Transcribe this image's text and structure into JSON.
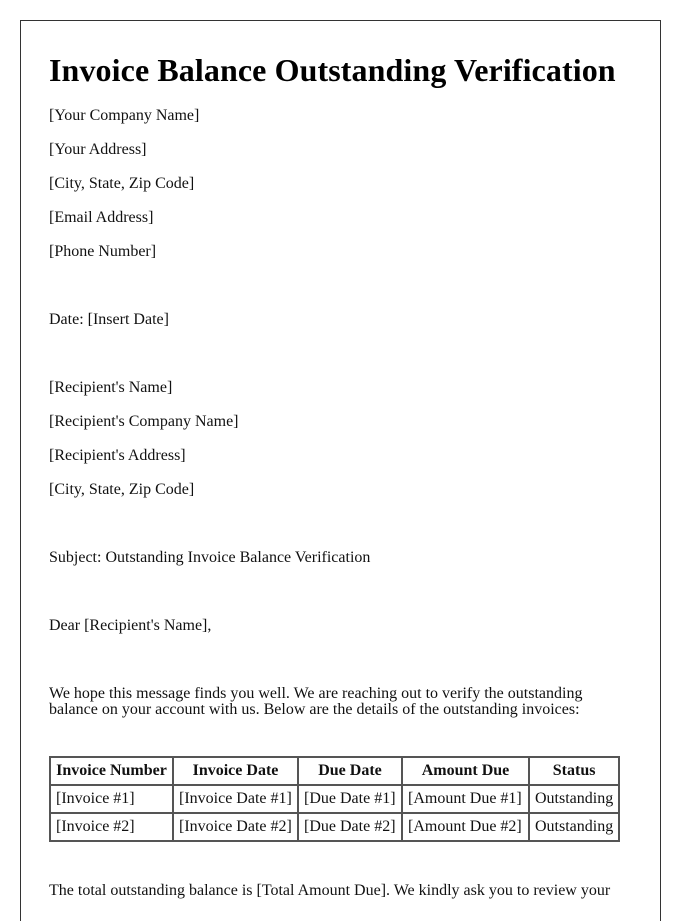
{
  "title": "Invoice Balance Outstanding Verification",
  "sender": {
    "company": "[Your Company Name]",
    "address": "[Your Address]",
    "city_state_zip": "[City, State, Zip Code]",
    "email": "[Email Address]",
    "phone": "[Phone Number]"
  },
  "date_line": "Date: [Insert Date]",
  "recipient": {
    "name": "[Recipient's Name]",
    "company": "[Recipient's Company Name]",
    "address": "[Recipient's Address]",
    "city_state_zip": "[City, State, Zip Code]"
  },
  "subject_line": "Subject: Outstanding Invoice Balance Verification",
  "salutation": "Dear [Recipient's Name],",
  "intro_paragraph": "We hope this message finds you well. We are reaching out to verify the outstanding balance on your account with us. Below are the details of the outstanding invoices:",
  "invoice_table": {
    "headers": [
      "Invoice Number",
      "Invoice Date",
      "Due Date",
      "Amount Due",
      "Status"
    ],
    "rows": [
      [
        "[Invoice #1]",
        "[Invoice Date #1]",
        "[Due Date #1]",
        "[Amount Due #1]",
        "Outstanding"
      ],
      [
        "[Invoice #2]",
        "[Invoice Date #2]",
        "[Due Date #2]",
        "[Amount Due #2]",
        "Outstanding"
      ]
    ]
  },
  "closing_paragraph": "The total outstanding balance is [Total Amount Due]. We kindly ask you to review your"
}
